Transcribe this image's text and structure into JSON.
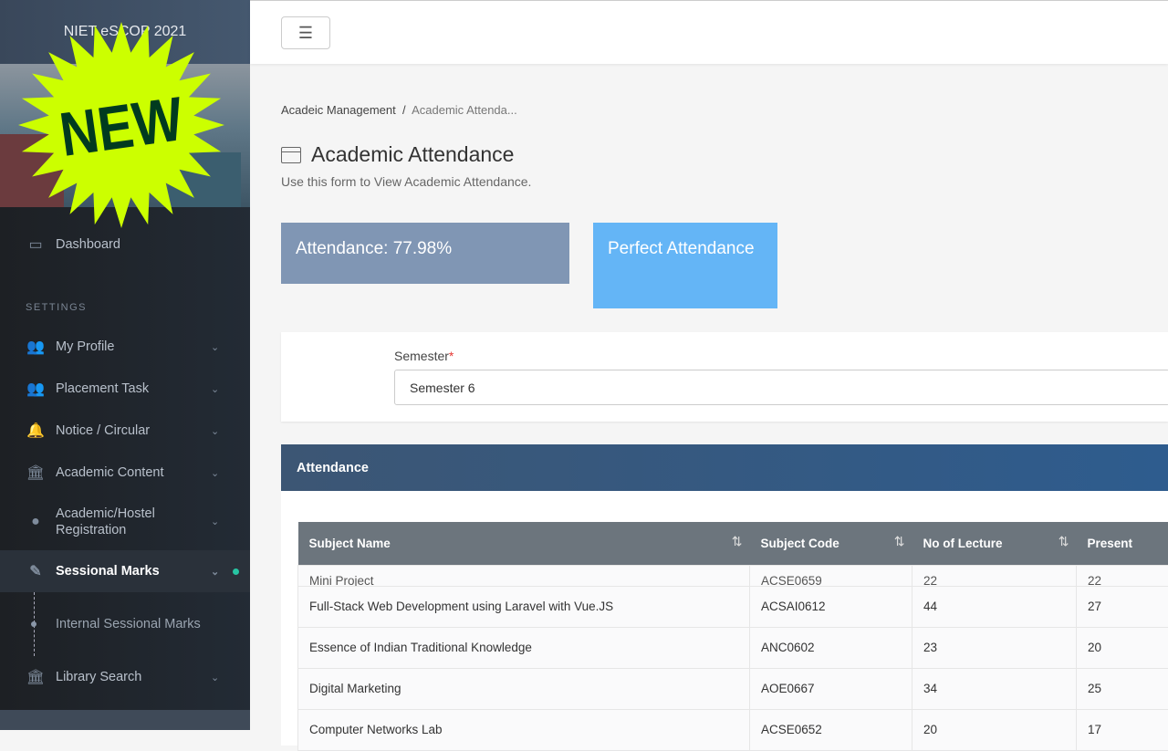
{
  "sidebar": {
    "brand": "NIET eSCOP 2021",
    "badge_text": "NEW",
    "dashboard": "Dashboard",
    "section": "SETTINGS",
    "items": [
      {
        "label": "My Profile",
        "icon": "users-icon"
      },
      {
        "label": "Placement Task",
        "icon": "users-icon"
      },
      {
        "label": "Notice / Circular",
        "icon": "bell-icon"
      },
      {
        "label": "Academic Content",
        "icon": "bank-icon"
      },
      {
        "label": "Academic/Hostel Registration",
        "icon": "user-circle-icon"
      },
      {
        "label": "Sessional Marks",
        "icon": "pencil-icon",
        "active": true
      },
      {
        "label": "Library Search",
        "icon": "bank-icon"
      }
    ],
    "sub_item": "Internal Sessional Marks"
  },
  "breadcrumb": {
    "parent": "Acadeic Management",
    "current": "Academic Attenda..."
  },
  "page": {
    "title": "Academic Attendance",
    "subtitle": "Use this form to View Academic Attendance."
  },
  "cards": {
    "attendance": "Attendance: 77.98%",
    "perfect": "Perfect Attendance"
  },
  "form": {
    "semester_label": "Semester",
    "semester_value": "Semester 6"
  },
  "table": {
    "title": "Attendance",
    "headers": [
      "Subject Name",
      "Subject Code",
      "No of Lecture",
      "Present"
    ],
    "rows": [
      [
        "Mini Project",
        "ACSE0659",
        "22",
        "22"
      ],
      [
        "Full-Stack Web Development using Laravel with Vue.JS",
        "ACSAI0612",
        "44",
        "27"
      ],
      [
        "Essence of Indian Traditional Knowledge",
        "ANC0602",
        "23",
        "20"
      ],
      [
        "Digital Marketing",
        "AOE0667",
        "34",
        "25"
      ],
      [
        "Computer Networks Lab",
        "ACSE0652",
        "20",
        "17"
      ]
    ]
  },
  "colors": {
    "accent": "#64b5f6",
    "attendance_card": "#8096b4",
    "badge": "#ccff00",
    "active_dot": "#27c5a3"
  }
}
